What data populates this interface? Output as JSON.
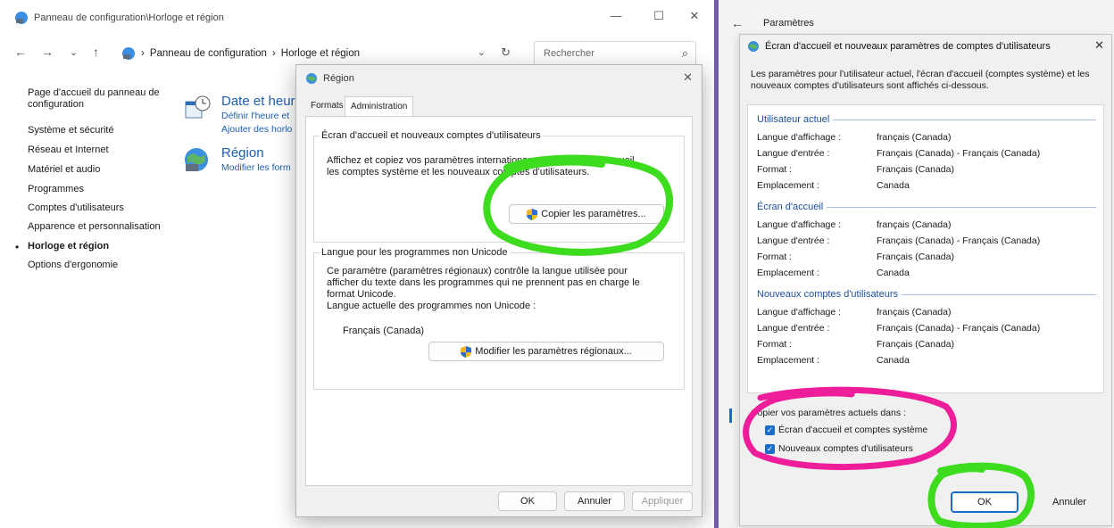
{
  "control_panel": {
    "title": "Panneau de configuration\\Horloge et région",
    "breadcrumb": [
      "Panneau de configuration",
      "Horloge et région"
    ],
    "search_placeholder": "Rechercher",
    "sidebar": [
      "Page d'accueil du panneau de",
      "configuration",
      "Système et sécurité",
      "Réseau et Internet",
      "Matériel et audio",
      "Programmes",
      "Comptes d'utilisateurs",
      "Apparence et personnalisation",
      "Horloge et région",
      "Options d'ergonomie"
    ],
    "categories": {
      "datetime": {
        "title": "Date et heure",
        "links": [
          "Définir l'heure et",
          "Ajouter des horlo"
        ]
      },
      "region": {
        "title": "Région",
        "links": [
          "Modifier les form"
        ]
      }
    }
  },
  "region_dialog": {
    "title": "Région",
    "tabs": [
      "Formats",
      "Administration"
    ],
    "welcome_group": {
      "legend": "Écran d'accueil et nouveaux comptes d'utilisateurs",
      "text": [
        "Affichez et copiez vos paramètres internationaux dans l'écran d'accueil,",
        "les comptes système et les nouveaux comptes d'utilisateurs."
      ],
      "button": "Copier les paramètres..."
    },
    "unicode_group": {
      "legend": "Langue pour les programmes non Unicode",
      "text": [
        "Ce paramètre (paramètres régionaux) contrôle la langue utilisée pour",
        "afficher du texte dans les programmes qui ne prennent pas en charge le",
        "format Unicode.",
        "Langue actuelle des programmes non Unicode :"
      ],
      "current_language": "Français (Canada)",
      "button": "Modifier les paramètres régionaux..."
    },
    "footer_buttons": [
      "OK",
      "Annuler",
      "Appliquer"
    ]
  },
  "settings_window": {
    "title": "Paramètres"
  },
  "welcome_dialog": {
    "title": "Écran d'accueil et nouveaux paramètres de comptes d'utilisateurs",
    "description": [
      "Les paramètres pour l'utilisateur actuel, l'écran d'accueil (comptes système) et les",
      "nouveaux comptes d'utilisateurs sont affichés ci-dessous."
    ],
    "sections": [
      {
        "heading": "Utilisateur actuel",
        "rows": [
          {
            "key": "Langue d'affichage :",
            "value": "français (Canada)"
          },
          {
            "key": "Langue d'entrée :",
            "value": "Français (Canada) - Français (Canada)"
          },
          {
            "key": "Format :",
            "value": "Français (Canada)"
          },
          {
            "key": "Emplacement :",
            "value": "Canada"
          }
        ]
      },
      {
        "heading": "Écran d'accueil",
        "rows": [
          {
            "key": "Langue d'affichage :",
            "value": "français (Canada)"
          },
          {
            "key": "Langue d'entrée :",
            "value": "Français (Canada) - Français (Canada)"
          },
          {
            "key": "Format :",
            "value": "Français (Canada)"
          },
          {
            "key": "Emplacement :",
            "value": "Canada"
          }
        ]
      },
      {
        "heading": "Nouveaux comptes d'utilisateurs",
        "rows": [
          {
            "key": "Langue d'affichage :",
            "value": "français (Canada)"
          },
          {
            "key": "Langue d'entrée :",
            "value": "Français (Canada) - Français (Canada)"
          },
          {
            "key": "Format :",
            "value": "Français (Canada)"
          },
          {
            "key": "Emplacement :",
            "value": "Canada"
          }
        ]
      }
    ],
    "copy_label": "Copier vos paramètres actuels dans :",
    "checkboxes": [
      {
        "label": "Écran d'accueil et comptes système",
        "checked": true
      },
      {
        "label": "Nouveaux comptes d'utilisateurs",
        "checked": true
      }
    ],
    "ok": "OK",
    "cancel": "Annuler"
  },
  "colors": {
    "accent_blue": "#1a6ec9",
    "link_blue": "#1d5fb3",
    "highlight_green": "#3ddc1e",
    "highlight_magenta": "#ee1e9b",
    "divider_purple": "#6f5aa6"
  }
}
